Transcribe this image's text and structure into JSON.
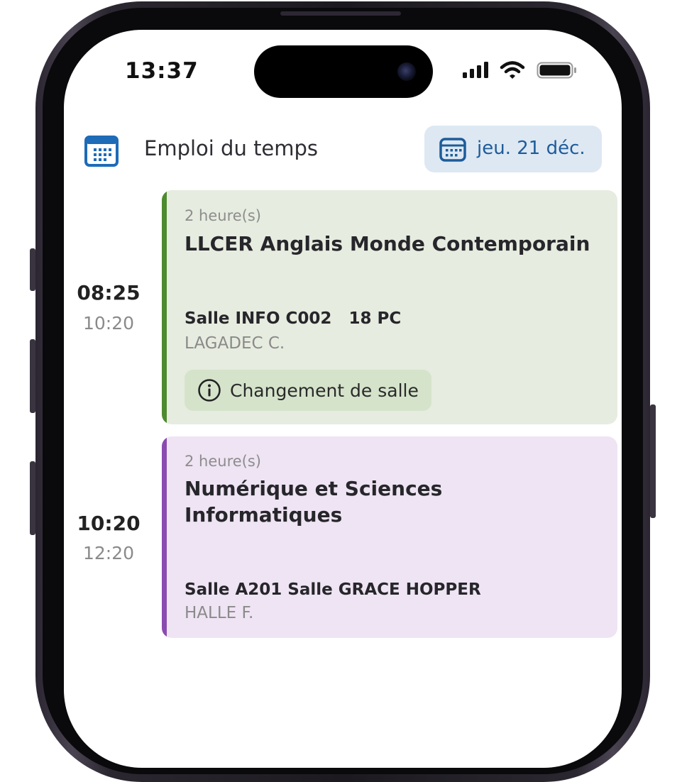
{
  "status_bar": {
    "time": "13:37"
  },
  "header": {
    "title": "Emploi du temps",
    "date_button": "jeu. 21 déc."
  },
  "lessons": [
    {
      "start": "08:25",
      "end": "10:20",
      "duration": "2 heure(s)",
      "subject": "LLCER Anglais Monde Contemporain",
      "room": "Salle INFO C002   18 PC",
      "teacher": "LAGADEC C.",
      "notice": "Changement de salle",
      "color": "#4e8a2e",
      "background": "#e6ecdf",
      "notice_background": "#d5e3cb"
    },
    {
      "start": "10:20",
      "end": "12:20",
      "duration": "2 heure(s)",
      "subject": "Numérique et Sciences Informatiques",
      "room": "Salle A201 Salle GRACE HOPPER",
      "teacher": "HALLE F.",
      "color": "#8a4bb0",
      "background": "#efe4f3"
    }
  ],
  "icons": {
    "header": "calendar-icon",
    "date_button": "calendar-icon",
    "notice": "info-icon",
    "status": [
      "cellular-signal-icon",
      "wifi-icon",
      "battery-icon"
    ]
  }
}
